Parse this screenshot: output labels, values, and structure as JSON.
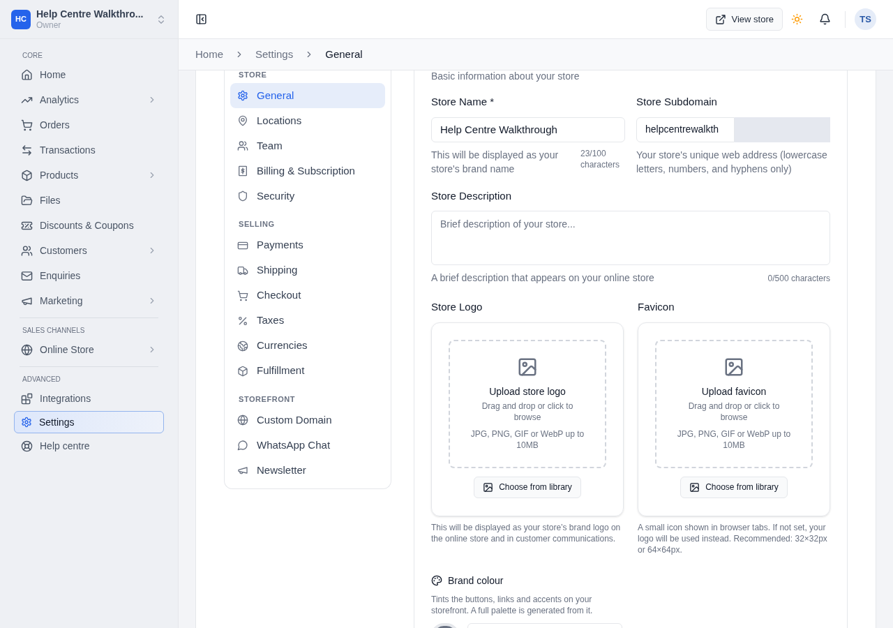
{
  "workspace": {
    "initials": "HC",
    "name": "Help Centre Walkthro...",
    "role": "Owner"
  },
  "sidebar": {
    "sections": [
      {
        "heading": "CORE",
        "items": [
          {
            "label": "Home",
            "has_submenu": false,
            "selected": false
          },
          {
            "label": "Analytics",
            "has_submenu": true,
            "selected": false
          },
          {
            "label": "Orders",
            "has_submenu": false,
            "selected": false
          },
          {
            "label": "Transactions",
            "has_submenu": false,
            "selected": false
          },
          {
            "label": "Products",
            "has_submenu": true,
            "selected": false
          },
          {
            "label": "Files",
            "has_submenu": false,
            "selected": false
          },
          {
            "label": "Discounts & Coupons",
            "has_submenu": false,
            "selected": false
          },
          {
            "label": "Customers",
            "has_submenu": true,
            "selected": false
          },
          {
            "label": "Enquiries",
            "has_submenu": false,
            "selected": false
          },
          {
            "label": "Marketing",
            "has_submenu": true,
            "selected": false
          }
        ]
      },
      {
        "heading": "SALES CHANNELS",
        "items": [
          {
            "label": "Online Store",
            "has_submenu": true,
            "selected": false
          }
        ]
      },
      {
        "heading": "ADVANCED",
        "items": [
          {
            "label": "Integrations",
            "has_submenu": false,
            "selected": false
          },
          {
            "label": "Settings",
            "has_submenu": false,
            "selected": true
          },
          {
            "label": "Help centre",
            "has_submenu": false,
            "selected": false
          }
        ]
      }
    ]
  },
  "topbar": {
    "view_store": "View store",
    "avatar": "TS"
  },
  "breadcrumb": [
    {
      "label": "Home",
      "current": false
    },
    {
      "label": "Settings",
      "current": false
    },
    {
      "label": "General",
      "current": true
    }
  ],
  "settings_nav": {
    "sections": [
      {
        "heading": "STORE",
        "items": [
          {
            "label": "General",
            "selected": true
          },
          {
            "label": "Locations",
            "selected": false
          },
          {
            "label": "Team",
            "selected": false
          },
          {
            "label": "Billing & Subscription",
            "selected": false
          },
          {
            "label": "Security",
            "selected": false
          }
        ]
      },
      {
        "heading": "SELLING",
        "items": [
          {
            "label": "Payments",
            "selected": false
          },
          {
            "label": "Shipping",
            "selected": false
          },
          {
            "label": "Checkout",
            "selected": false
          },
          {
            "label": "Taxes",
            "selected": false
          },
          {
            "label": "Currencies",
            "selected": false
          },
          {
            "label": "Fulfillment",
            "selected": false
          }
        ]
      },
      {
        "heading": "STOREFRONT",
        "items": [
          {
            "label": "Custom Domain",
            "selected": false
          },
          {
            "label": "WhatsApp Chat",
            "selected": false
          },
          {
            "label": "Newsletter",
            "selected": false
          }
        ]
      }
    ]
  },
  "form": {
    "subtitle": "Basic information about your store",
    "store_name": {
      "label": "Store Name *",
      "value": "Help Centre Walkthrough",
      "help": "This will be displayed as your store's brand name",
      "counter": "23/100 characters"
    },
    "subdomain": {
      "label": "Store Subdomain",
      "value": "helpcentrewalkth",
      "help": "Your store's unique web address (lowercase letters, numbers, and hyphens only)"
    },
    "description": {
      "label": "Store Description",
      "placeholder": "Brief description of your store...",
      "help": "A brief description that appears on your online store",
      "counter": "0/500 characters"
    },
    "uploads": [
      {
        "label": "Store Logo",
        "title": "Upload store logo",
        "hint": "Drag and drop or click to browse",
        "formats": "JPG, PNG, GIF or WebP up to 10MB",
        "button": "Choose from library",
        "help": "This will be displayed as your store’s brand logo on the online store and in customer communications."
      },
      {
        "label": "Favicon",
        "title": "Upload favicon",
        "hint": "Drag and drop or click to browse",
        "formats": "JPG, PNG, GIF or WebP up to 10MB",
        "button": "Choose from library",
        "help": "A small icon shown in browser tabs. If not set, your logo will be used instead. Recommended: 32×32px or 64×64px."
      }
    ],
    "brand_colour": {
      "label": "Brand colour",
      "help": "Tints the buttons, links and accents on your storefront. A full palette is generated from it."
    }
  }
}
